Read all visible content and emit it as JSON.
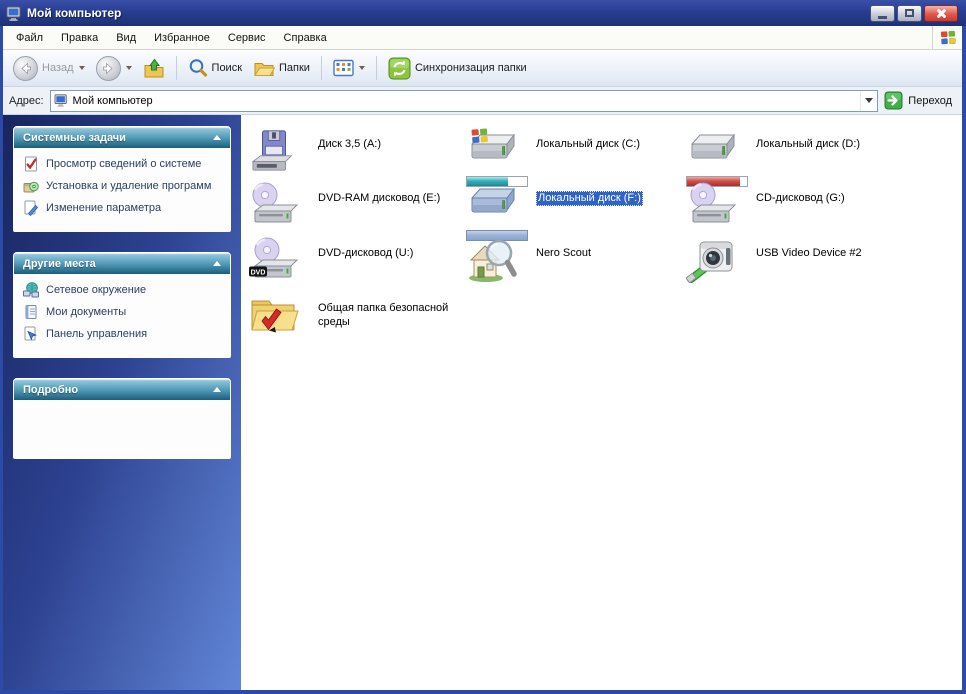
{
  "window": {
    "title": "Мой компьютер"
  },
  "menu": {
    "items": [
      "Файл",
      "Правка",
      "Вид",
      "Избранное",
      "Сервис",
      "Справка"
    ]
  },
  "toolbar": {
    "back_label": "Назад",
    "search_label": "Поиск",
    "folders_label": "Папки",
    "sync_label": "Синхронизация папки"
  },
  "address_bar": {
    "label": "Адрес:",
    "value": "Мой компьютер",
    "go_label": "Переход"
  },
  "sidebar": {
    "panels": [
      {
        "title": "Системные задачи",
        "items": [
          {
            "label": "Просмотр сведений о системе",
            "icon": "system-info"
          },
          {
            "label": "Установка и удаление программ",
            "icon": "add-remove-programs"
          },
          {
            "label": "Изменение параметра",
            "icon": "change-setting"
          }
        ]
      },
      {
        "title": "Другие места",
        "items": [
          {
            "label": "Сетевое окружение",
            "icon": "network-places"
          },
          {
            "label": "Мои документы",
            "icon": "my-documents"
          },
          {
            "label": "Панель управления",
            "icon": "control-panel"
          }
        ]
      },
      {
        "title": "Подробно",
        "items": []
      }
    ]
  },
  "content": {
    "dvd_badge": "DVD",
    "items": [
      {
        "label": "Диск 3,5 (A:)",
        "icon": "floppy-drive"
      },
      {
        "label": "Локальный диск (C:)",
        "icon": "hdd-system",
        "usage": {
          "percent": 68,
          "kind": "teal"
        }
      },
      {
        "label": "Локальный диск (D:)",
        "icon": "hdd",
        "usage": {
          "percent": 88,
          "kind": "red"
        }
      },
      {
        "label": "DVD-RAM дисковод (E:)",
        "icon": "optical-drive"
      },
      {
        "label": "Локальный диск (F:)",
        "icon": "hdd-selected",
        "selected": true,
        "usage": {
          "percent": 100,
          "kind": "blue"
        }
      },
      {
        "label": "CD-дисковод (G:)",
        "icon": "optical-drive"
      },
      {
        "label": "DVD-дисковод (U:)",
        "icon": "dvd-drive"
      },
      {
        "label": "Nero Scout",
        "icon": "nero-scout"
      },
      {
        "label": "USB Video Device #2",
        "icon": "usb-camera"
      },
      {
        "label": "Общая папка безопасной среды",
        "icon": "shared-folder"
      }
    ]
  },
  "colors": {
    "titlebar": "#24388c",
    "selection": "#2f63c5",
    "panel_header_top": "#8ec6da",
    "panel_header_bottom": "#1c586f",
    "sidebar_gradient_left": "#18255f",
    "sidebar_gradient_right": "#6286d6",
    "usage_teal": "#2fa8b0",
    "usage_red": "#c04040",
    "go_green": "#3fae49",
    "sync_green": "#7ec142"
  }
}
